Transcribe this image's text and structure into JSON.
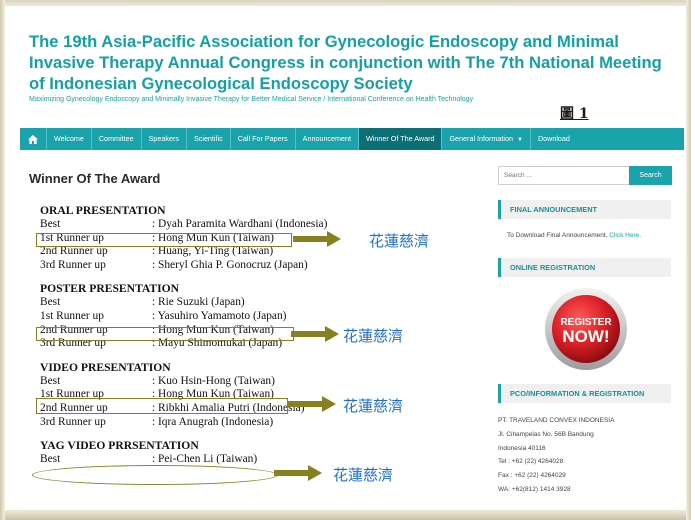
{
  "header": {
    "title": "The 19th Asia-Pacific Association for Gynecologic Endoscopy and Minimal Invasive Therapy Annual Congress in conjunction with The 7th National Meeting of Indonesian Gynecological Endoscopy Society",
    "tagline": "Maximizing Gynecology Endoscopy and Minimally Invasive Therapy for Better Medical Service / International Conference on Health Technology",
    "figure_label": "圖 1"
  },
  "nav": {
    "items": [
      "Welcome",
      "Committee",
      "Speakers",
      "Scientific",
      "Call For Papers",
      "Announcement",
      "Winner Of The Award",
      "General Information",
      "Download"
    ]
  },
  "main": {
    "heading": "Winner Of The Award",
    "groups": [
      {
        "title": "ORAL PRESENTATION",
        "rows": [
          {
            "role": "Best",
            "name": ": Dyah Paramita Wardhani (Indonesia)"
          },
          {
            "role": "1st Runner up",
            "name": ": Hong Mun Kun (Taiwan)"
          },
          {
            "role": "2nd Runner up",
            "name": ": Huang, Yi-Ting (Taiwan)"
          },
          {
            "role": "3rd Runner up",
            "name": ": Sheryl Ghia P. Gonocruz (Japan)"
          }
        ]
      },
      {
        "title": "POSTER PRESENTATION",
        "rows": [
          {
            "role": "Best",
            "name": ": Rie Suzuki (Japan)"
          },
          {
            "role": "1st Runner up",
            "name": ": Yasuhiro Yamamoto (Japan)"
          },
          {
            "role": "2nd Runner up",
            "name": ": Hong Mun Kun (Taiwan)"
          },
          {
            "role": "3rd Runner up",
            "name": ": Mayu Shimomukai (Japan)"
          }
        ]
      },
      {
        "title": "VIDEO PRESENTATION",
        "rows": [
          {
            "role": "Best",
            "name": ": Kuo Hsin-Hong (Taiwan)"
          },
          {
            "role": "1st Runner up",
            "name": ": Hong Mun Kun (Taiwan)"
          },
          {
            "role": "2nd Runner up",
            "name": ": Ribkhi Amalia Putri (Indonesia)"
          },
          {
            "role": "3rd Runner up",
            "name": ": Iqra Anugrah (Indonesia)"
          }
        ]
      },
      {
        "title": "YAG VIDEO PRRSENTATION",
        "rows": [
          {
            "role": "Best",
            "name": ": Pei-Chen Li (Taiwan)"
          }
        ]
      }
    ],
    "annotation": "花蓮慈濟"
  },
  "sidebar": {
    "search_placeholder": "Search ...",
    "search_button": "Search",
    "final_heading": "FINAL ANNOUNCEMENT",
    "final_text": "To Download Final Announcement,",
    "final_link": "Click Here.",
    "online_heading": "ONLINE REGISTRATION",
    "register_line1": "REGISTER",
    "register_line2": "NOW!",
    "pco_heading": "PCO/INFORMATION & REGISTRATION",
    "contact": [
      "PT. TRAVELAND CONVEX INDONESIA",
      "Jl. Cihampelas No. 56B Bandung",
      "Indonesia 40116",
      "Tel : +62 (22) 4264028",
      "Fax : +62 (22) 4264029",
      "WA: +62(812) 1414 3928"
    ]
  },
  "colors": {
    "accent": "#1aa3ab",
    "active_nav": "#0d6f76",
    "highlight": "#86801f",
    "annotation": "#1f6fd0",
    "register": "#d91f26"
  }
}
